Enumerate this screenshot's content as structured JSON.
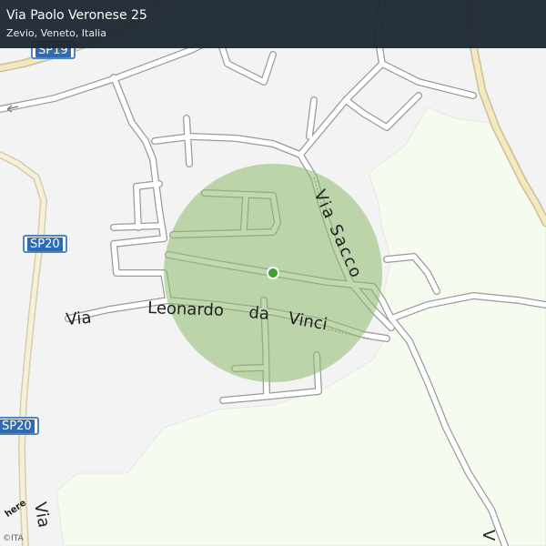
{
  "header": {
    "title": "Via Paolo Veronese 25",
    "subtitle": "Zevio, Veneto, Italia"
  },
  "road_labels": {
    "via_sacco": "Via Sacco",
    "via": "Via",
    "leonardo": "Leonardo",
    "da": "da",
    "vinci": "Vinci",
    "via_bottom": "Via",
    "v_right": "V"
  },
  "shields": {
    "sp19": "SP19",
    "sp20_a": "SP20",
    "sp20_b": "SP20"
  },
  "footer": {
    "logo": "here",
    "copyright": "©ITA"
  },
  "colors": {
    "header_bg": "#1e2933",
    "accuracy_circle": "#9dc480",
    "location_dot": "#3aa335",
    "park_fill": "#f6fbef",
    "major_road": "#f3e6b6",
    "road_casing": "#9a9a9a",
    "shield_blue": "#2f6bb3"
  },
  "location": {
    "accuracy_shown": true,
    "marker": "location-dot"
  }
}
